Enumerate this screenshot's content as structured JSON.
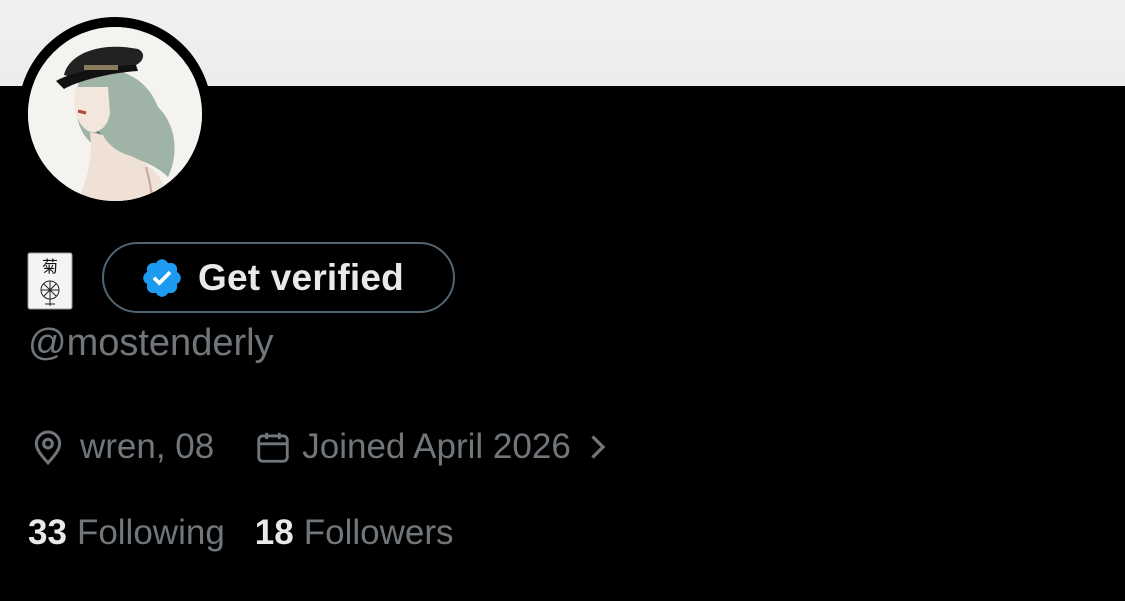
{
  "profile": {
    "verify_label": "Get verified",
    "handle": "@mostenderly",
    "location": "wren, 08",
    "joined": "Joined April 2026",
    "following_count": "33",
    "following_label": "Following",
    "followers_count": "18",
    "followers_label": "Followers",
    "name_emoji_char": "菊"
  },
  "colors": {
    "background": "#000000",
    "banner": "#efefef",
    "badge_blue": "#1d9bf0",
    "muted_text": "#71767b",
    "primary_text": "#e7e9ea"
  },
  "icons": {
    "verified": "verified-badge-icon",
    "location": "location-pin-icon",
    "joined": "calendar-icon",
    "more": "chevron-right-icon"
  }
}
